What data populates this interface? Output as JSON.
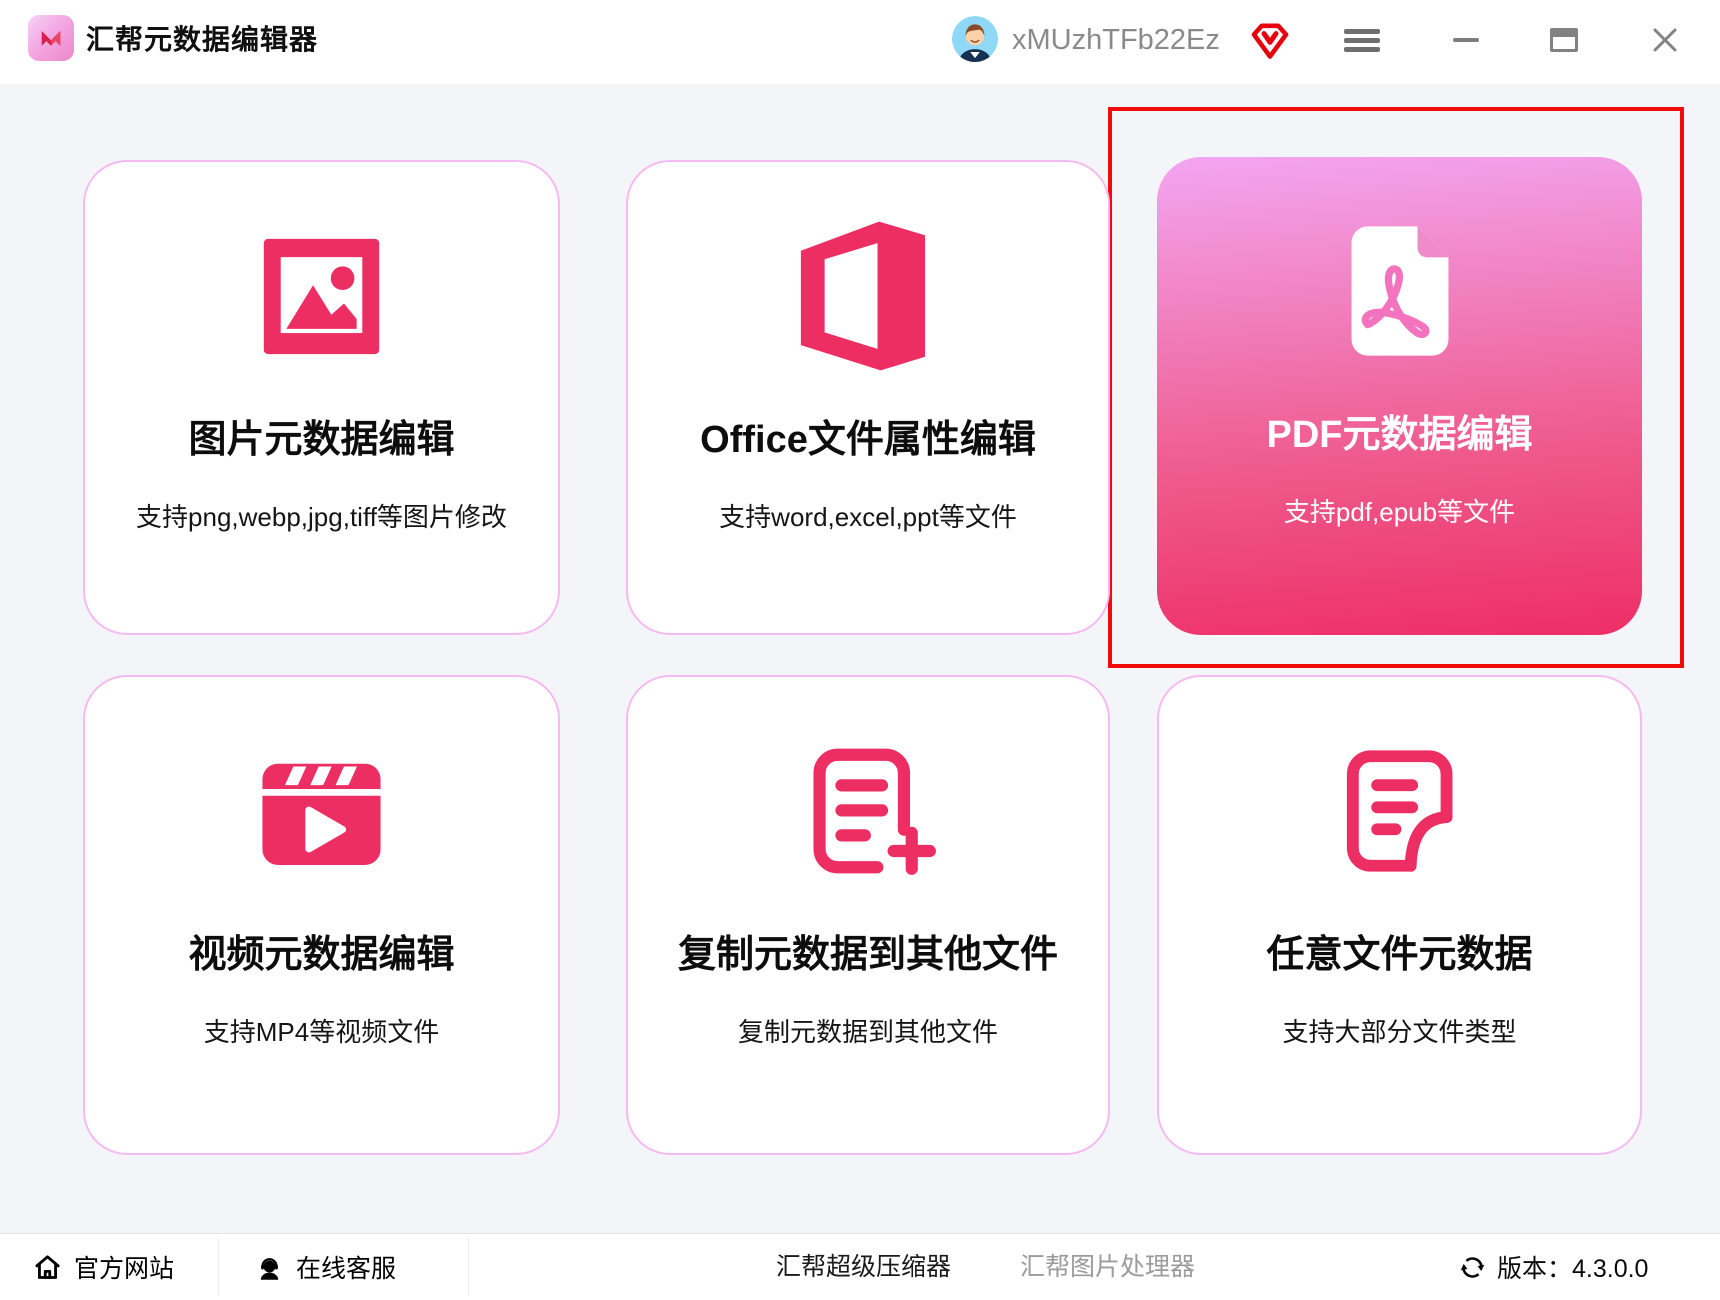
{
  "titlebar": {
    "app_title": "汇帮元数据编辑器",
    "username": "xMUzhTFb22Ez",
    "icons": [
      "app-logo",
      "user-avatar",
      "vip-badge-icon",
      "hamburger-menu-icon",
      "minimize-icon",
      "maximize-icon",
      "close-icon"
    ]
  },
  "cards": [
    {
      "title": "图片元数据编辑",
      "subtitle": "支持png,webp,jpg,tiff等图片修改",
      "icon": "image-icon",
      "highlighted": false
    },
    {
      "title": "Office文件属性编辑",
      "subtitle": "支持word,excel,ppt等文件",
      "icon": "office-icon",
      "highlighted": false
    },
    {
      "title": "PDF元数据编辑",
      "subtitle": "支持pdf,epub等文件",
      "icon": "pdf-icon",
      "highlighted": true
    },
    {
      "title": "视频元数据编辑",
      "subtitle": "支持MP4等视频文件",
      "icon": "video-icon",
      "highlighted": false
    },
    {
      "title": "复制元数据到其他文件",
      "subtitle": "复制元数据到其他文件",
      "icon": "copy-metadata-icon",
      "highlighted": false
    },
    {
      "title": "任意文件元数据",
      "subtitle": "支持大部分文件类型",
      "icon": "any-file-icon",
      "highlighted": false
    }
  ],
  "footer": {
    "official_site": "官方网站",
    "online_service": "在线客服",
    "super_compressor": "汇帮超级压缩器",
    "image_processor": "汇帮图片处理器",
    "version": "版本：4.3.0.0",
    "icons": [
      "home-icon",
      "headset-icon",
      "refresh-icon"
    ]
  },
  "colors": {
    "accent_pink": "#ED2E63",
    "card_border": "#F5BAF1",
    "highlight_red": "#F10B0B",
    "pdf_gradient_top": "#F3A6F2",
    "pdf_gradient_bottom": "#ED2E66",
    "background": "#F4F5F9",
    "vip_red": "#E8000D",
    "username_gray": "#8A8A8A"
  }
}
